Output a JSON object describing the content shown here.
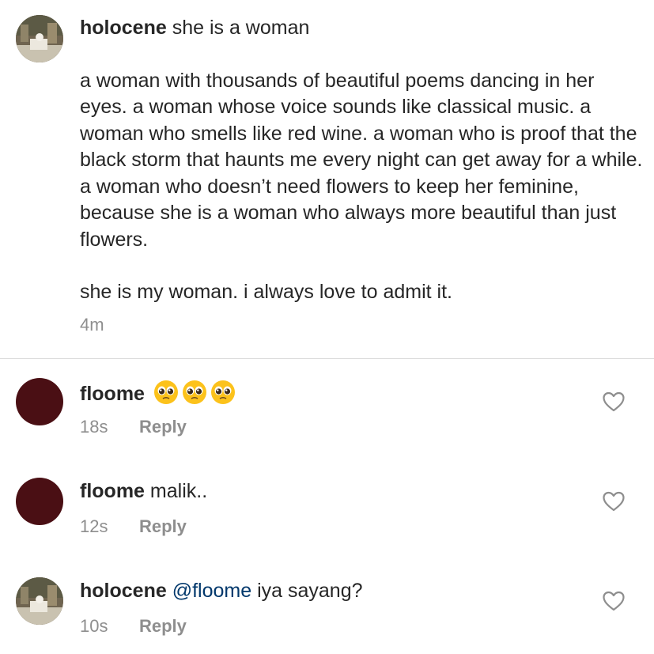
{
  "caption": {
    "username": "holocene",
    "first_line": "she is a woman",
    "body": "a woman with thousands of beautiful poems dancing in her eyes. a woman whose voice sounds like classical music. a woman who smells like red wine. a woman who is proof that the black storm that haunts me every night can get away for a while. a woman who doesn’t need flowers to keep her feminine, because she is a woman who always more beautiful than just flowers.",
    "closing": "she is my woman. i always love to admit it.",
    "time": "4m"
  },
  "comments": [
    {
      "username": "floome",
      "text": "",
      "emoji": [
        "pleading-face",
        "pleading-face",
        "pleading-face"
      ],
      "time": "18s",
      "reply_label": "Reply"
    },
    {
      "username": "floome",
      "text": "malik..",
      "time": "12s",
      "reply_label": "Reply"
    },
    {
      "username": "holocene",
      "mention": "@floome",
      "text": "iya sayang?",
      "time": "10s",
      "reply_label": "Reply"
    }
  ],
  "colors": {
    "text": "#262626",
    "muted": "#8e8e8e",
    "mention": "#00376b",
    "divider": "#dbdbdb",
    "floome_avatar": "#4a0f14"
  }
}
